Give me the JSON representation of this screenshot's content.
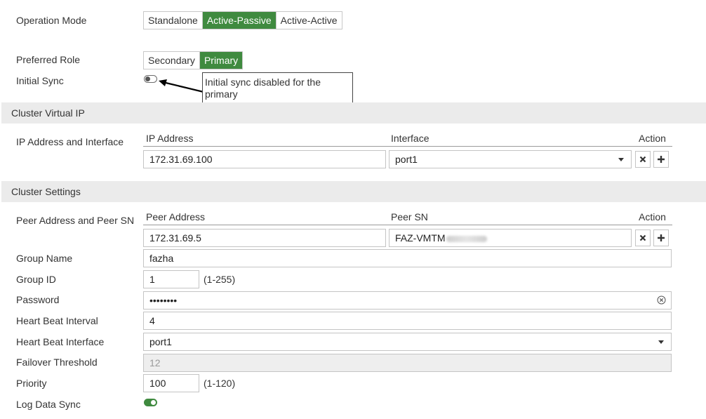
{
  "ha": {
    "operation_mode": {
      "label": "Operation Mode",
      "options": [
        "Standalone",
        "Active-Passive",
        "Active-Active"
      ],
      "selected": "Active-Passive"
    },
    "preferred_role": {
      "label": "Preferred Role",
      "options": [
        "Secondary",
        "Primary"
      ],
      "selected": "Primary"
    },
    "initial_sync": {
      "label": "Initial Sync",
      "state": "off",
      "callout": "Initial sync disabled for the primary"
    }
  },
  "cluster_virtual_ip": {
    "section_title": "Cluster Virtual IP",
    "row_label": "IP Address and Interface",
    "columns": {
      "ip": "IP Address",
      "interface": "Interface",
      "action": "Action"
    },
    "ip_value": "172.31.69.100",
    "interface_value": "port1"
  },
  "cluster_settings": {
    "section_title": "Cluster Settings",
    "peer_row_label": "Peer Address and Peer SN",
    "columns": {
      "peer_address": "Peer Address",
      "peer_sn": "Peer SN",
      "action": "Action"
    },
    "peer_address_value": "172.31.69.5",
    "peer_sn_value": "FAZ-VMTM",
    "group_name": {
      "label": "Group Name",
      "value": "fazha"
    },
    "group_id": {
      "label": "Group ID",
      "value": "1",
      "hint": "(1-255)"
    },
    "password": {
      "label": "Password",
      "value": "••••••••"
    },
    "heartbeat_interval": {
      "label": "Heart Beat Interval",
      "value": "4"
    },
    "heartbeat_interface": {
      "label": "Heart Beat Interface",
      "value": "port1"
    },
    "failover_threshold": {
      "label": "Failover Threshold",
      "value": "12"
    },
    "priority": {
      "label": "Priority",
      "value": "100",
      "hint": "(1-120)"
    },
    "log_data_sync": {
      "label": "Log Data Sync",
      "state": "on"
    }
  },
  "colors": {
    "accent_green": "#3f8a3f",
    "section_bg": "#ebebeb",
    "border": "#c4c4c4"
  }
}
